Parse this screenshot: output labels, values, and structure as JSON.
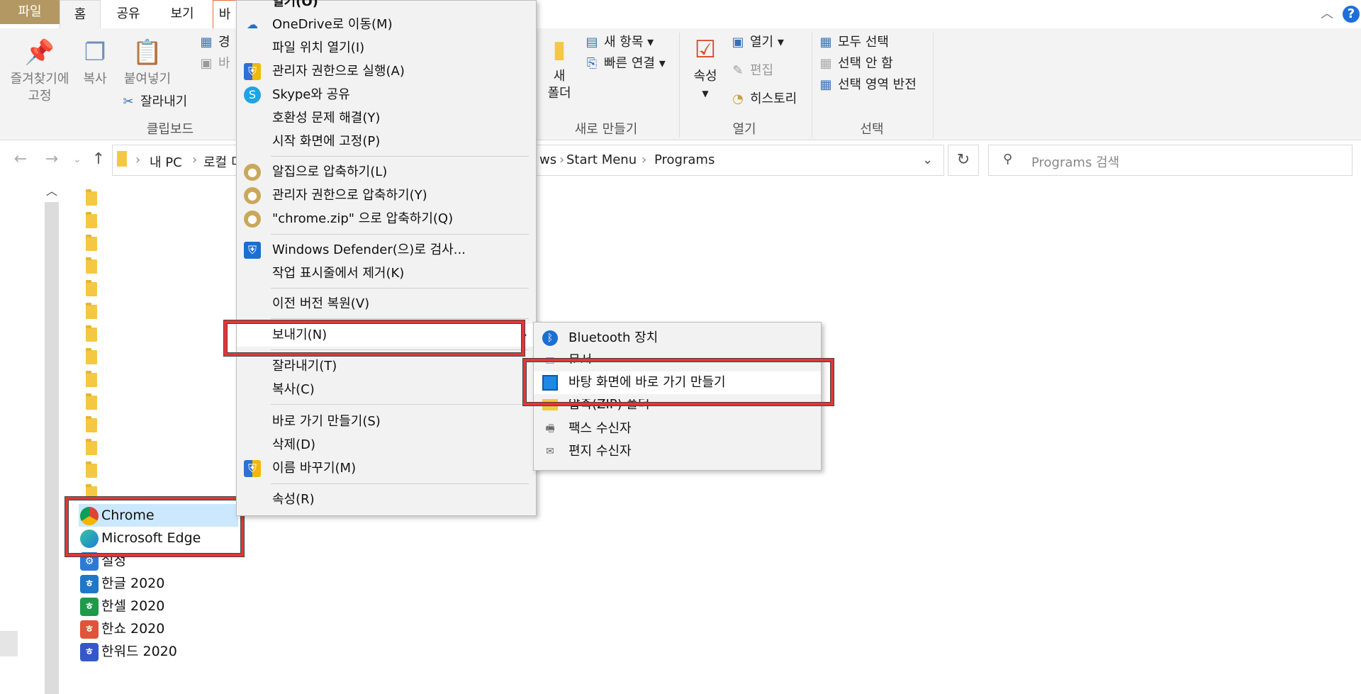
{
  "tabs": {
    "file": "파일",
    "home": "홈",
    "share": "공유",
    "view": "보기",
    "manage_partial": "바"
  },
  "ribbon": {
    "clipboard": {
      "pin": "즐겨찾기에\n고정",
      "copy": "복사",
      "paste": "붙여넣기",
      "cut": "잘라내기",
      "path_partial": "경",
      "paste_shortcut_partial": "바",
      "label": "클립보드"
    },
    "new": {
      "new_item": "새 항목",
      "easy_access": "빠른 연결",
      "new_folder": "새\n폴더",
      "label": "새로 만들기"
    },
    "open": {
      "properties": "속성",
      "open": "열기",
      "edit": "편집",
      "history": "히스토리",
      "label": "열기"
    },
    "select": {
      "select_all": "모두 선택",
      "select_none": "선택 안 함",
      "invert": "선택 영역 반전",
      "label": "선택"
    }
  },
  "address": {
    "this_pc": "내 PC",
    "local_partial": "로컬 디",
    "crumb_tail_partial": "ws",
    "start_menu": "Start Menu",
    "programs": "Programs",
    "search_placeholder": "Programs 검색"
  },
  "context_menu": {
    "open_partial": "열기(O)",
    "onedrive": "OneDrive로 이동(M)",
    "open_location": "파일 위치 열기(I)",
    "run_admin": "관리자 권한으로 실행(A)",
    "skype": "Skype와 공유",
    "compat": "호환성 문제 해결(Y)",
    "pin_start": "시작 화면에 고정(P)",
    "alzip": "알집으로 압축하기(L)",
    "alzip_admin": "관리자 권한으로 압축하기(Y)",
    "alzip_name": "\"chrome.zip\" 으로 압축하기(Q)",
    "defender": "Windows Defender(으)로 검사...",
    "unpin_taskbar": "작업 표시줄에서 제거(K)",
    "restore": "이전 버전 복원(V)",
    "send_to": "보내기(N)",
    "cut": "잘라내기(T)",
    "copy": "복사(C)",
    "shortcut": "바로 가기 만들기(S)",
    "delete": "삭제(D)",
    "rename": "이름 바꾸기(M)",
    "properties": "속성(R)"
  },
  "submenu": {
    "bluetooth": "Bluetooth 장치",
    "documents_partial": "문서",
    "desktop_shortcut": "바탕 화면에 바로 가기 만들기",
    "zip_partial": "압축(ZIP) 폴더",
    "fax": "팩스 수신자",
    "mail": "편지 수신자"
  },
  "files": {
    "chrome": "Chrome",
    "edge": "Microsoft Edge",
    "settings_partial": "설정",
    "hangul": "한글 2020",
    "hancell": "한셀 2020",
    "hanshow": "한쇼 2020",
    "hanword": "한워드 2020"
  },
  "colors": {
    "highlight_box": "#e53535",
    "selection": "#cce8ff",
    "file_tab": "#b39864"
  }
}
